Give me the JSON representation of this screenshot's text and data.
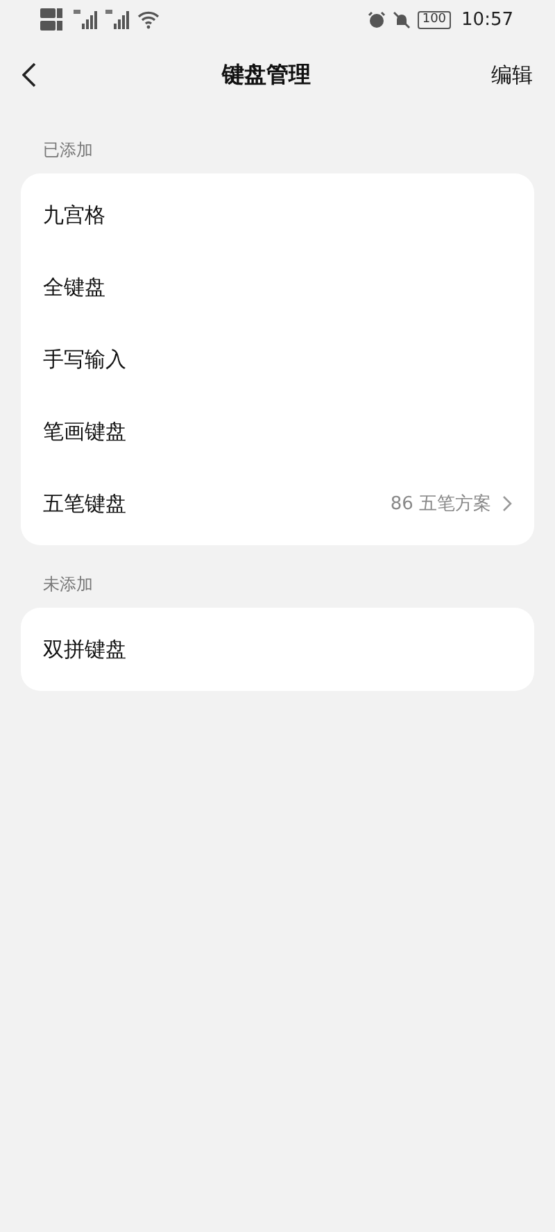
{
  "status_bar": {
    "battery": "100",
    "time": "10:57"
  },
  "header": {
    "title": "键盘管理",
    "action": "编辑"
  },
  "sections": [
    {
      "label": "已添加",
      "items": [
        {
          "label": "九宫格"
        },
        {
          "label": "全键盘"
        },
        {
          "label": "手写输入"
        },
        {
          "label": "笔画键盘"
        },
        {
          "label": "五笔键盘",
          "value": "86 五笔方案"
        }
      ]
    },
    {
      "label": "未添加",
      "items": [
        {
          "label": "双拼键盘"
        }
      ]
    }
  ]
}
